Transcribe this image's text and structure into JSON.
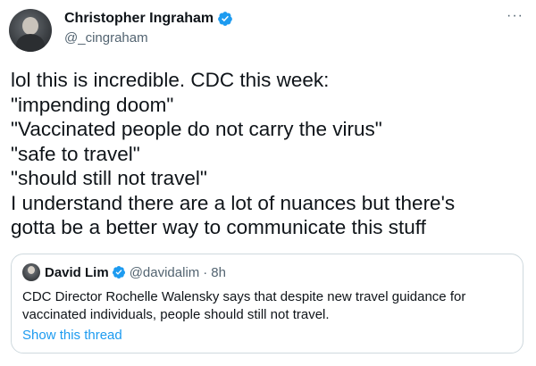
{
  "author": {
    "name": "Christopher Ingraham",
    "handle": "@_cingraham",
    "verified": true
  },
  "tweet_lines": [
    "lol this is incredible. CDC this week:",
    "\"impending doom\"",
    "\"Vaccinated people do not carry the virus\"",
    "\"safe to travel\"",
    "\"should still not travel\"",
    "I understand there are a lot of nuances but there's",
    "gotta be a better way to communicate this stuff"
  ],
  "quoted": {
    "name": "David Lim",
    "handle": "@davidalim",
    "separator": "·",
    "time": "8h",
    "verified": true,
    "text_lines": [
      "CDC Director Rochelle Walensky says that despite new travel guidance for",
      "vaccinated individuals, people should still not travel."
    ],
    "thread_link": "Show this thread"
  },
  "more_label": "···",
  "colors": {
    "text": "#0f1419",
    "secondary": "#536471",
    "accent": "#1d9bf0",
    "border": "#cfd9de"
  },
  "icons": {
    "verified": "verified-badge-icon",
    "more": "more-options-icon"
  }
}
